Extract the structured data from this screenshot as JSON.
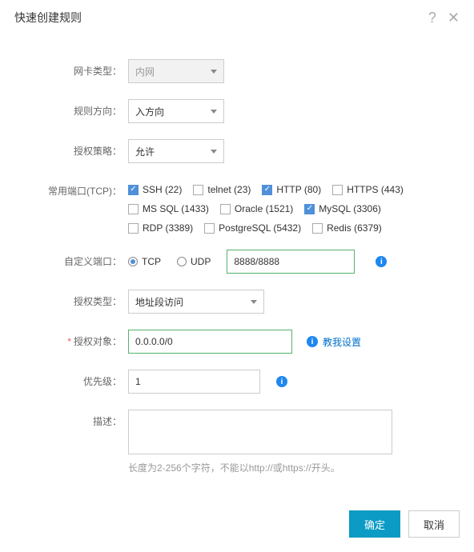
{
  "header": {
    "title": "快速创建规则"
  },
  "labels": {
    "nic_type": "网卡类型：",
    "direction": "规则方向：",
    "auth_policy": "授权策略：",
    "common_ports": "常用端口(TCP)：",
    "custom_port": "自定义端口：",
    "auth_type": "授权类型：",
    "auth_object": "授权对象：",
    "priority": "优先级：",
    "description": "描述："
  },
  "values": {
    "nic_type": "内网",
    "direction": "入方向",
    "auth_policy": "允许",
    "protocol": "TCP",
    "port": "8888/8888",
    "auth_type": "地址段访问",
    "auth_object": "0.0.0.0/0",
    "priority": "1",
    "description": ""
  },
  "protocols": {
    "tcp": "TCP",
    "udp": "UDP"
  },
  "ports": [
    {
      "label": "SSH (22)",
      "checked": true
    },
    {
      "label": "telnet (23)",
      "checked": false
    },
    {
      "label": "HTTP (80)",
      "checked": true
    },
    {
      "label": "HTTPS (443)",
      "checked": false
    },
    {
      "label": "MS SQL (1433)",
      "checked": false
    },
    {
      "label": "Oracle (1521)",
      "checked": false
    },
    {
      "label": "MySQL (3306)",
      "checked": true
    },
    {
      "label": "RDP (3389)",
      "checked": false
    },
    {
      "label": "PostgreSQL (5432)",
      "checked": false
    },
    {
      "label": "Redis (6379)",
      "checked": false
    }
  ],
  "links": {
    "teach_me": "教我设置"
  },
  "hints": {
    "desc": "长度为2-256个字符，不能以http://或https://开头。"
  },
  "footer": {
    "ok": "确定",
    "cancel": "取消"
  }
}
